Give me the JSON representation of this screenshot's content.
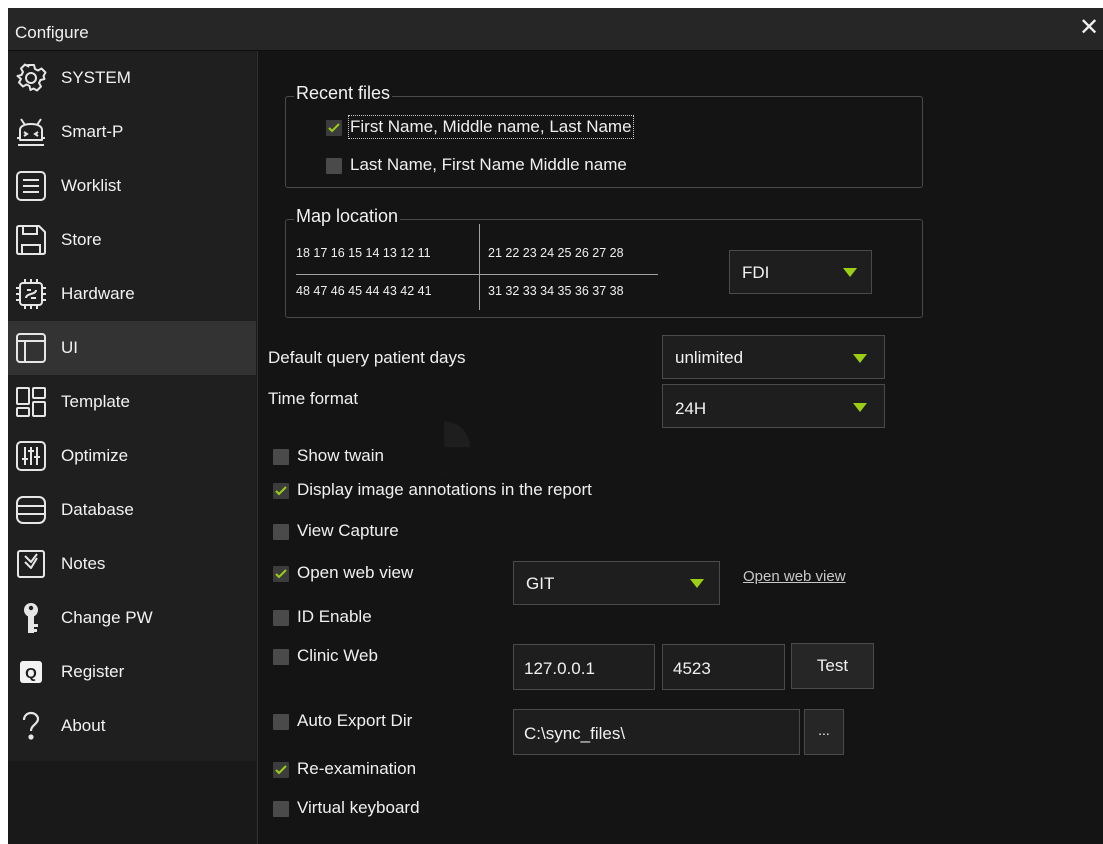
{
  "window": {
    "title": "Configure",
    "close_symbol": "✕"
  },
  "colors": {
    "accent": "#9bcf16",
    "background": "#141414",
    "sidebar": "#1f1f1f",
    "active_item": "#333333"
  },
  "sidebar": {
    "items": [
      {
        "label": "SYSTEM",
        "icon": "gear-icon"
      },
      {
        "label": "Smart-P",
        "icon": "robot-icon"
      },
      {
        "label": "Worklist",
        "icon": "list-icon"
      },
      {
        "label": "Store",
        "icon": "floppy-disk-icon"
      },
      {
        "label": "Hardware",
        "icon": "chip-icon"
      },
      {
        "label": "UI",
        "icon": "layout-icon",
        "active": true
      },
      {
        "label": "Template",
        "icon": "template-grid-icon"
      },
      {
        "label": "Optimize",
        "icon": "sliders-icon"
      },
      {
        "label": "Database",
        "icon": "database-icon"
      },
      {
        "label": "Notes",
        "icon": "notes-check-icon"
      },
      {
        "label": "Change PW",
        "icon": "key-icon"
      },
      {
        "label": "Register",
        "icon": "register-q-icon",
        "badge": "Q"
      },
      {
        "label": "About",
        "icon": "question-mark-icon"
      }
    ]
  },
  "recent_files": {
    "title": "Recent files",
    "options": [
      {
        "label": "First Name, Middle name, Last Name",
        "checked": true
      },
      {
        "label": "Last Name, First Name Middle name",
        "checked": false
      }
    ]
  },
  "map_location": {
    "title": "Map location",
    "upper_right": "18 17 16 15 14 13 12 11",
    "upper_left": "21 22 23 24 25 26 27 28",
    "lower_right": "48 47 46 45 44 43 42 41",
    "lower_left": "31 32 33 34 35 36 37 38",
    "notation": "FDI"
  },
  "settings": {
    "query_days_label": "Default query patient days",
    "query_days_value": "unlimited",
    "time_format_label": "Time format",
    "time_format_value": "24H"
  },
  "options": {
    "show_twain": {
      "label": "Show twain",
      "checked": false
    },
    "display_annotations": {
      "label": "Display image annotations in the report",
      "checked": true
    },
    "view_capture": {
      "label": "View Capture",
      "checked": false
    },
    "open_web_view": {
      "label": "Open web view",
      "checked": true,
      "select": "GIT",
      "link": "Open web view"
    },
    "id_enable": {
      "label": "ID Enable",
      "checked": false
    },
    "clinic_web": {
      "label": "Clinic Web",
      "checked": false,
      "ip": "127.0.0.1",
      "port": "4523",
      "test_label": "Test"
    },
    "auto_export": {
      "label": "Auto Export Dir",
      "checked": false,
      "path": "C:\\sync_files\\",
      "browse_label": "..."
    },
    "re_examination": {
      "label": "Re-examination",
      "checked": true
    },
    "virtual_keyboard": {
      "label": "Virtual keyboard",
      "checked": false
    }
  }
}
